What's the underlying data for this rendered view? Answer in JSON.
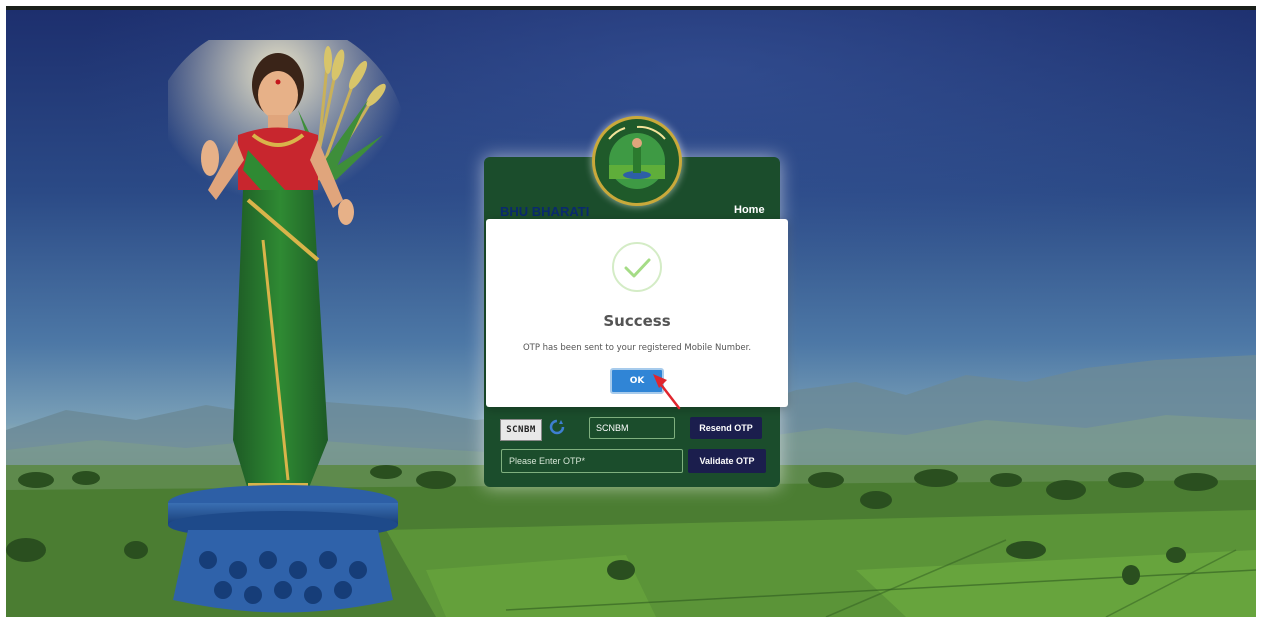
{
  "login_card": {
    "brand": "BHU BHARATI",
    "home_link": "Home",
    "captcha_code": "SCNBM",
    "captcha_value": "SCNBM",
    "resend_otp_label": "Resend OTP",
    "otp_placeholder": "Please Enter OTP*",
    "validate_otp_label": "Validate OTP"
  },
  "modal": {
    "title": "Success",
    "message": "OTP has been sent to your registered Mobile Number.",
    "ok_label": "OK"
  },
  "colors": {
    "card_green": "#1b4d2c",
    "button_navy": "#1b1e4d",
    "ok_blue": "#3085d6",
    "success_green": "#a5dc86",
    "cursor_red": "#e0262e"
  },
  "icons": {
    "success": "check-circle-icon",
    "refresh": "refresh-icon",
    "emblem": "goddess-emblem-logo"
  }
}
